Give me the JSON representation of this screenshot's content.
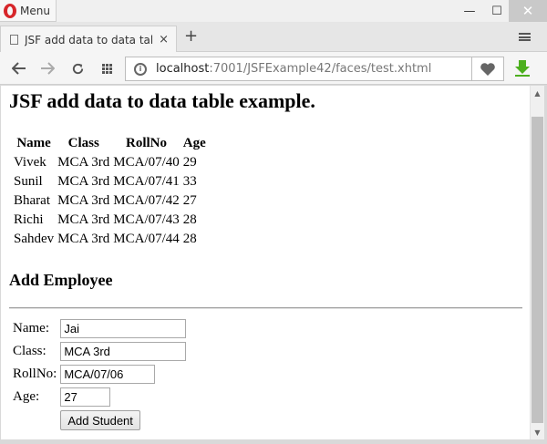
{
  "browser": {
    "menu_label": "Menu",
    "tab_title": "JSF add data to data table",
    "tab_close": "×",
    "new_tab": "+",
    "url_host": "localhost",
    "url_rest": ":7001/JSFExample42/faces/test.xhtml",
    "window_controls": {
      "minimize": "—",
      "maximize": "☐",
      "close": "✕"
    },
    "colors": {
      "opera_red": "#d7262a",
      "download_green": "#4caf1e"
    }
  },
  "page": {
    "heading": "JSF add data to data table example.",
    "table": {
      "headers": [
        "Name",
        "Class",
        "RollNo",
        "Age"
      ],
      "rows": [
        [
          "Vivek",
          "MCA 3rd",
          "MCA/07/40",
          "29"
        ],
        [
          "Sunil",
          "MCA 3rd",
          "MCA/07/41",
          "33"
        ],
        [
          "Bharat",
          "MCA 3rd",
          "MCA/07/42",
          "27"
        ],
        [
          "Richi",
          "MCA 3rd",
          "MCA/07/43",
          "28"
        ],
        [
          "Sahdev",
          "MCA 3rd",
          "MCA/07/44",
          "28"
        ]
      ]
    },
    "form": {
      "title": "Add Employee",
      "name_label": "Name:",
      "name_value": "Jai",
      "class_label": "Class:",
      "class_value": "MCA 3rd",
      "rollno_label": "RollNo:",
      "rollno_value": "MCA/07/06",
      "age_label": "Age:",
      "age_value": "27",
      "submit_label": "Add Student"
    }
  }
}
